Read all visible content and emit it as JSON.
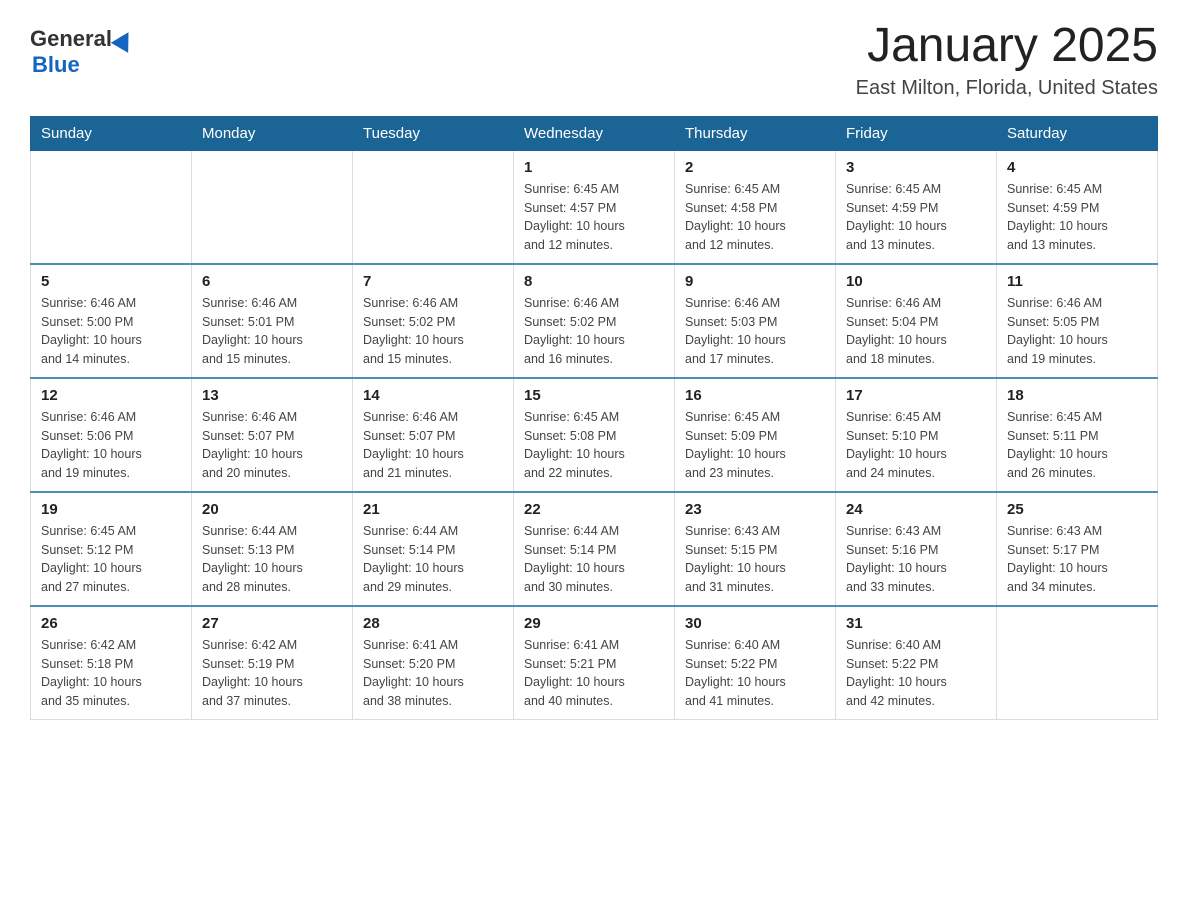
{
  "header": {
    "logo_text_general": "General",
    "logo_text_blue": "Blue",
    "title": "January 2025",
    "subtitle": "East Milton, Florida, United States"
  },
  "calendar": {
    "days_of_week": [
      "Sunday",
      "Monday",
      "Tuesday",
      "Wednesday",
      "Thursday",
      "Friday",
      "Saturday"
    ],
    "weeks": [
      [
        {
          "day": "",
          "info": ""
        },
        {
          "day": "",
          "info": ""
        },
        {
          "day": "",
          "info": ""
        },
        {
          "day": "1",
          "info": "Sunrise: 6:45 AM\nSunset: 4:57 PM\nDaylight: 10 hours\nand 12 minutes."
        },
        {
          "day": "2",
          "info": "Sunrise: 6:45 AM\nSunset: 4:58 PM\nDaylight: 10 hours\nand 12 minutes."
        },
        {
          "day": "3",
          "info": "Sunrise: 6:45 AM\nSunset: 4:59 PM\nDaylight: 10 hours\nand 13 minutes."
        },
        {
          "day": "4",
          "info": "Sunrise: 6:45 AM\nSunset: 4:59 PM\nDaylight: 10 hours\nand 13 minutes."
        }
      ],
      [
        {
          "day": "5",
          "info": "Sunrise: 6:46 AM\nSunset: 5:00 PM\nDaylight: 10 hours\nand 14 minutes."
        },
        {
          "day": "6",
          "info": "Sunrise: 6:46 AM\nSunset: 5:01 PM\nDaylight: 10 hours\nand 15 minutes."
        },
        {
          "day": "7",
          "info": "Sunrise: 6:46 AM\nSunset: 5:02 PM\nDaylight: 10 hours\nand 15 minutes."
        },
        {
          "day": "8",
          "info": "Sunrise: 6:46 AM\nSunset: 5:02 PM\nDaylight: 10 hours\nand 16 minutes."
        },
        {
          "day": "9",
          "info": "Sunrise: 6:46 AM\nSunset: 5:03 PM\nDaylight: 10 hours\nand 17 minutes."
        },
        {
          "day": "10",
          "info": "Sunrise: 6:46 AM\nSunset: 5:04 PM\nDaylight: 10 hours\nand 18 minutes."
        },
        {
          "day": "11",
          "info": "Sunrise: 6:46 AM\nSunset: 5:05 PM\nDaylight: 10 hours\nand 19 minutes."
        }
      ],
      [
        {
          "day": "12",
          "info": "Sunrise: 6:46 AM\nSunset: 5:06 PM\nDaylight: 10 hours\nand 19 minutes."
        },
        {
          "day": "13",
          "info": "Sunrise: 6:46 AM\nSunset: 5:07 PM\nDaylight: 10 hours\nand 20 minutes."
        },
        {
          "day": "14",
          "info": "Sunrise: 6:46 AM\nSunset: 5:07 PM\nDaylight: 10 hours\nand 21 minutes."
        },
        {
          "day": "15",
          "info": "Sunrise: 6:45 AM\nSunset: 5:08 PM\nDaylight: 10 hours\nand 22 minutes."
        },
        {
          "day": "16",
          "info": "Sunrise: 6:45 AM\nSunset: 5:09 PM\nDaylight: 10 hours\nand 23 minutes."
        },
        {
          "day": "17",
          "info": "Sunrise: 6:45 AM\nSunset: 5:10 PM\nDaylight: 10 hours\nand 24 minutes."
        },
        {
          "day": "18",
          "info": "Sunrise: 6:45 AM\nSunset: 5:11 PM\nDaylight: 10 hours\nand 26 minutes."
        }
      ],
      [
        {
          "day": "19",
          "info": "Sunrise: 6:45 AM\nSunset: 5:12 PM\nDaylight: 10 hours\nand 27 minutes."
        },
        {
          "day": "20",
          "info": "Sunrise: 6:44 AM\nSunset: 5:13 PM\nDaylight: 10 hours\nand 28 minutes."
        },
        {
          "day": "21",
          "info": "Sunrise: 6:44 AM\nSunset: 5:14 PM\nDaylight: 10 hours\nand 29 minutes."
        },
        {
          "day": "22",
          "info": "Sunrise: 6:44 AM\nSunset: 5:14 PM\nDaylight: 10 hours\nand 30 minutes."
        },
        {
          "day": "23",
          "info": "Sunrise: 6:43 AM\nSunset: 5:15 PM\nDaylight: 10 hours\nand 31 minutes."
        },
        {
          "day": "24",
          "info": "Sunrise: 6:43 AM\nSunset: 5:16 PM\nDaylight: 10 hours\nand 33 minutes."
        },
        {
          "day": "25",
          "info": "Sunrise: 6:43 AM\nSunset: 5:17 PM\nDaylight: 10 hours\nand 34 minutes."
        }
      ],
      [
        {
          "day": "26",
          "info": "Sunrise: 6:42 AM\nSunset: 5:18 PM\nDaylight: 10 hours\nand 35 minutes."
        },
        {
          "day": "27",
          "info": "Sunrise: 6:42 AM\nSunset: 5:19 PM\nDaylight: 10 hours\nand 37 minutes."
        },
        {
          "day": "28",
          "info": "Sunrise: 6:41 AM\nSunset: 5:20 PM\nDaylight: 10 hours\nand 38 minutes."
        },
        {
          "day": "29",
          "info": "Sunrise: 6:41 AM\nSunset: 5:21 PM\nDaylight: 10 hours\nand 40 minutes."
        },
        {
          "day": "30",
          "info": "Sunrise: 6:40 AM\nSunset: 5:22 PM\nDaylight: 10 hours\nand 41 minutes."
        },
        {
          "day": "31",
          "info": "Sunrise: 6:40 AM\nSunset: 5:22 PM\nDaylight: 10 hours\nand 42 minutes."
        },
        {
          "day": "",
          "info": ""
        }
      ]
    ]
  }
}
